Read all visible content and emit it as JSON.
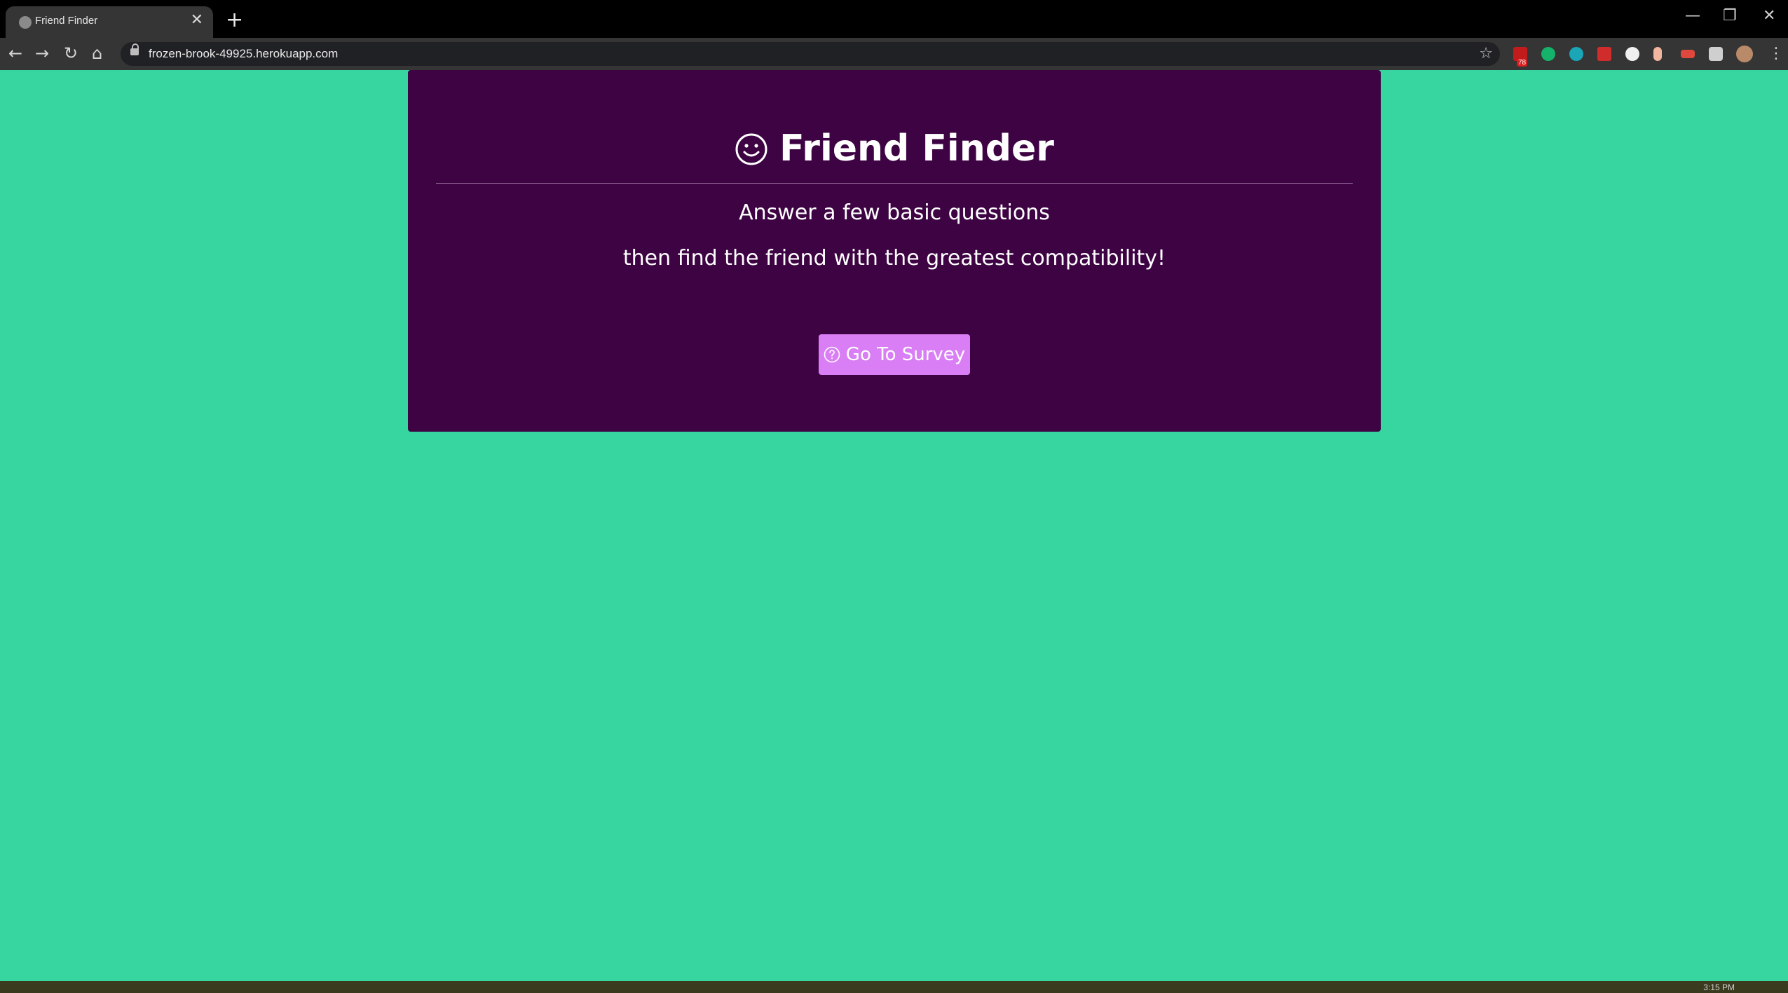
{
  "browser": {
    "tab_title": "Friend Finder",
    "tab_close": "✕",
    "new_tab": "+",
    "url": "frozen-brook-49925.herokuapp.com",
    "back": "←",
    "forward": "→",
    "reload": "↻",
    "home": "⌂",
    "bookmark_star": "☆",
    "ext_badge_count": "78",
    "window_minimize": "—",
    "window_restore": "❐",
    "window_close": "✕",
    "menu": "⋮"
  },
  "page": {
    "title": "Friend Finder",
    "line1": "Answer a few basic questions",
    "line2": "then find the friend with the greatest compatibility!",
    "button_label": "Go To Survey"
  },
  "taskbar": {
    "clock": "3:15 PM"
  },
  "colors": {
    "page_bg": "#37d6a0",
    "card_bg": "#3d0343",
    "button_bg": "#d97ef5",
    "text": "#ffffff"
  }
}
